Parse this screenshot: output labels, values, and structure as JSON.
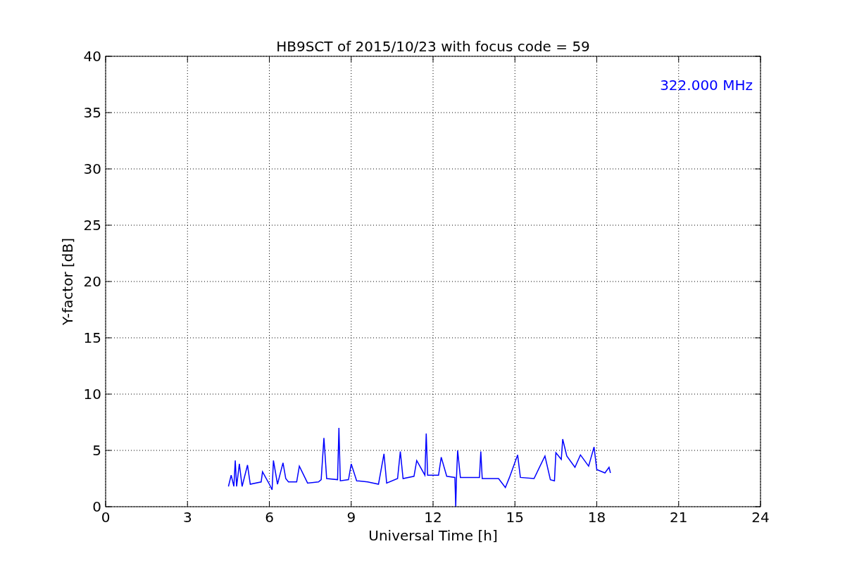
{
  "chart_data": {
    "type": "line",
    "title": "HB9SCT of 2015/10/23 with focus code = 59",
    "xlabel": "Universal Time [h]",
    "ylabel": "Y-factor [dB]",
    "x": [
      4.5,
      4.6,
      4.7,
      4.75,
      4.8,
      4.9,
      5.0,
      5.2,
      5.3,
      5.7,
      5.75,
      6.0,
      6.1,
      6.15,
      6.3,
      6.5,
      6.6,
      6.7,
      7.0,
      7.1,
      7.4,
      7.8,
      7.9,
      8.0,
      8.1,
      8.5,
      8.55,
      8.6,
      8.9,
      9.0,
      9.2,
      9.6,
      10.0,
      10.2,
      10.3,
      10.7,
      10.8,
      10.9,
      11.3,
      11.4,
      11.7,
      11.75,
      11.8,
      12.2,
      12.3,
      12.5,
      12.8,
      12.83,
      12.86,
      12.9,
      13.0,
      13.7,
      13.75,
      13.8,
      14.4,
      14.65,
      14.8,
      15.1,
      15.2,
      15.7,
      16.1,
      16.3,
      16.45,
      16.5,
      16.7,
      16.75,
      16.9,
      17.2,
      17.4,
      17.7,
      17.9,
      18.0,
      18.3,
      18.45,
      18.5
    ],
    "series": [
      {
        "name": "322.000 MHz",
        "color": "#0000ff",
        "values": [
          1.8,
          2.8,
          1.8,
          4.1,
          1.8,
          3.8,
          1.8,
          3.7,
          2.0,
          2.2,
          3.1,
          2.0,
          1.5,
          4.1,
          2.0,
          3.9,
          2.5,
          2.2,
          2.2,
          3.6,
          2.1,
          2.2,
          2.4,
          6.1,
          2.5,
          2.4,
          7.0,
          2.3,
          2.4,
          3.8,
          2.3,
          2.2,
          2.0,
          4.7,
          2.1,
          2.5,
          4.9,
          2.5,
          2.7,
          4.1,
          2.8,
          6.5,
          2.8,
          2.8,
          4.4,
          2.7,
          2.6,
          0.0,
          2.6,
          5.0,
          2.6,
          2.6,
          4.9,
          2.5,
          2.5,
          1.7,
          2.6,
          4.6,
          2.6,
          2.5,
          4.5,
          2.4,
          2.3,
          4.8,
          4.2,
          6.0,
          4.5,
          3.5,
          4.6,
          3.6,
          5.3,
          3.3,
          3.0,
          3.5,
          3.0
        ]
      }
    ],
    "xlim": [
      0,
      24
    ],
    "ylim": [
      0,
      40
    ],
    "xticks": [
      0,
      3,
      6,
      9,
      12,
      15,
      18,
      21,
      24
    ],
    "yticks": [
      0,
      5,
      10,
      15,
      20,
      25,
      30,
      35,
      40
    ],
    "grid": true
  }
}
